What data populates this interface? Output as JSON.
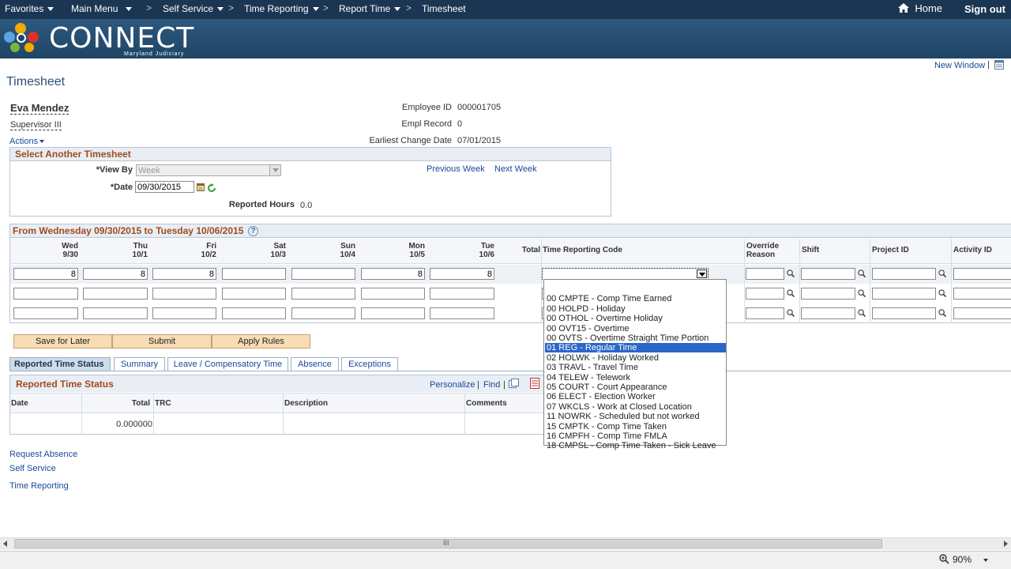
{
  "nav": {
    "favorites": "Favorites",
    "main_menu": "Main Menu",
    "self_service": "Self Service",
    "time_reporting": "Time Reporting",
    "report_time": "Report Time",
    "timesheet": "Timesheet",
    "home": "Home",
    "sign_out": "Sign out",
    "separator": ">"
  },
  "brand": {
    "name": "CONNECT",
    "subtitle": "Maryland Judiciary"
  },
  "page": {
    "new_window": "New Window",
    "title": "Timesheet"
  },
  "employee": {
    "name": "Eva Mendez",
    "job_title": "Supervisor III",
    "actions": "Actions",
    "id_label": "Employee ID",
    "id_value": "000001705",
    "record_label": "Empl Record",
    "record_value": "0",
    "earliest_label": "Earliest Change Date",
    "earliest_value": "07/01/2015"
  },
  "select": {
    "title": "Select Another Timesheet",
    "view_by_label": "*View By",
    "view_by_value": "Week",
    "date_label": "*Date",
    "date_value": "09/30/2015",
    "previous_week": "Previous Week",
    "next_week": "Next Week",
    "reported_hours_label": "Reported Hours",
    "reported_hours_value": "0.0"
  },
  "period": {
    "title": "From Wednesday 09/30/2015 to Tuesday 10/06/2015",
    "help": "?"
  },
  "grid": {
    "days": [
      {
        "day": "Wed",
        "date": "9/30"
      },
      {
        "day": "Thu",
        "date": "10/1"
      },
      {
        "day": "Fri",
        "date": "10/2"
      },
      {
        "day": "Sat",
        "date": "10/3"
      },
      {
        "day": "Sun",
        "date": "10/4"
      },
      {
        "day": "Mon",
        "date": "10/5"
      },
      {
        "day": "Tue",
        "date": "10/6"
      }
    ],
    "total": "Total",
    "trc": "Time Reporting Code",
    "override1": "Override",
    "override2": "Reason",
    "shift": "Shift",
    "project": "Project ID",
    "activity": "Activity ID",
    "row1": [
      "8",
      "8",
      "8",
      "",
      "",
      "8",
      "8"
    ]
  },
  "trc_options": [
    "",
    "00 CMPTE - Comp Time Earned",
    "00 HOLPD - Holiday",
    "00 OTHOL - Overtime Holiday",
    "00 OVT15 - Overtime",
    "00 OVTS - Overtime Straight Time Portion",
    "01 REG - Regular Time",
    "02 HOLWK - Holiday Worked",
    "03 TRAVL - Travel Time",
    "04 TELEW - Telework",
    "05 COURT - Court Appearance",
    "06 ELECT - Election Worker",
    "07 WKCLS - Work at Closed Location",
    "11 NOWRK - Scheduled but not worked",
    "15 CMPTK - Comp Time Taken",
    "16 CMPFH - Comp Time FMLA",
    "18 CMPSL - Comp Time Taken - Sick Leave"
  ],
  "buttons": {
    "save": "Save for Later",
    "submit": "Submit",
    "apply": "Apply Rules"
  },
  "tabs": [
    "Reported Time Status",
    "Summary",
    "Leave / Compensatory Time",
    "Absence",
    "Exceptions"
  ],
  "status": {
    "title": "Reported Time Status",
    "personalize": "Personalize",
    "find": "Find",
    "sep": "|",
    "cols": {
      "date": "Date",
      "total": "Total",
      "trc": "TRC",
      "description": "Description",
      "comments": "Comments"
    },
    "total_value": "0.000000"
  },
  "links": {
    "request_absence": "Request Absence",
    "self_service": "Self Service",
    "time_reporting": "Time Reporting"
  },
  "statusbar": {
    "zoom": "90%",
    "grip": "III"
  }
}
